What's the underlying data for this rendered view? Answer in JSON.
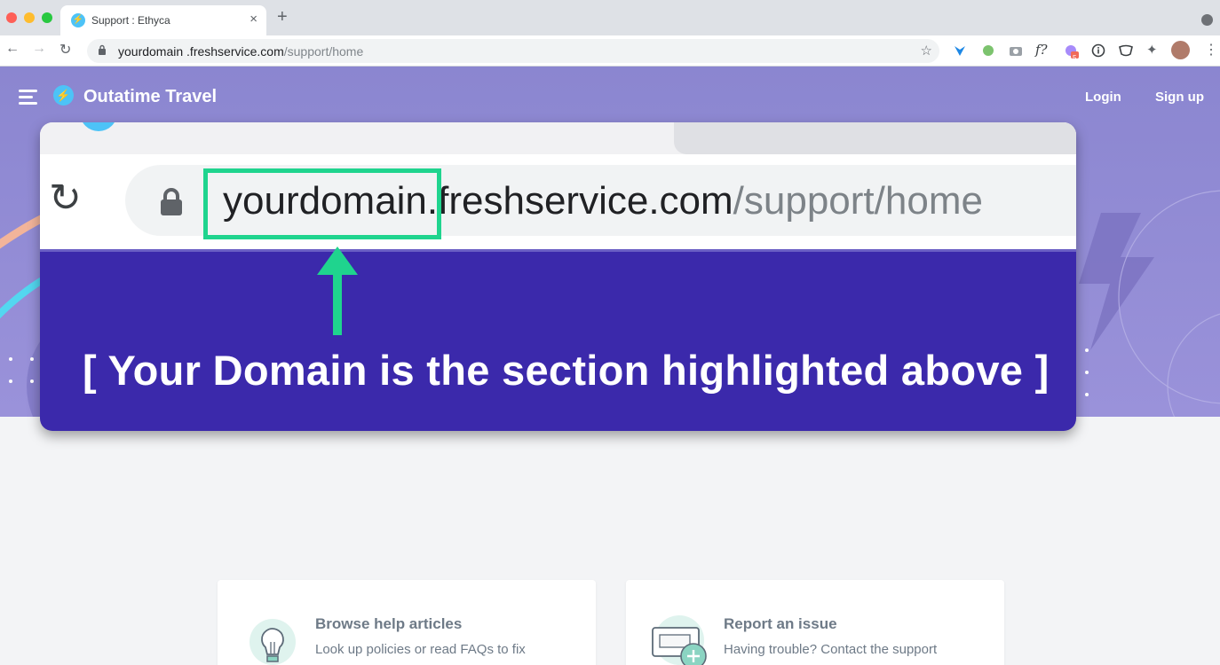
{
  "browser": {
    "tab_title": "Support : Ethyca",
    "tab_close": "×",
    "new_tab": "+",
    "url_domain": "yourdomain .freshservice.com",
    "url_path": "/support/home",
    "extension_badge": "5",
    "icons": [
      "back-icon",
      "forward-icon",
      "reload-icon",
      "lock-icon",
      "star-icon",
      "extension-icons",
      "puzzle-icon",
      "menu-icon"
    ]
  },
  "header": {
    "brand_name": "Outatime Travel",
    "login_label": "Login",
    "signup_label": "Sign up"
  },
  "callout": {
    "url_domain": "yourdomain",
    "url_host_rest": ".freshservice.com",
    "url_path": "/support/home",
    "caption": "[ Your Domain is the section highlighted above ]",
    "highlight_color": "#1fd48e",
    "background_color": "#3b29ab"
  },
  "cards": [
    {
      "title": "Browse help articles",
      "description": "Look up policies or read FAQs to fix",
      "icon": "lightbulb-icon"
    },
    {
      "title": "Report an issue",
      "description": "Having trouble? Contact the support",
      "icon": "ticket-add-icon"
    }
  ],
  "colors": {
    "hero": "#8b86d0",
    "accent": "#4dc3f7",
    "page_bg": "#f3f4f6"
  }
}
